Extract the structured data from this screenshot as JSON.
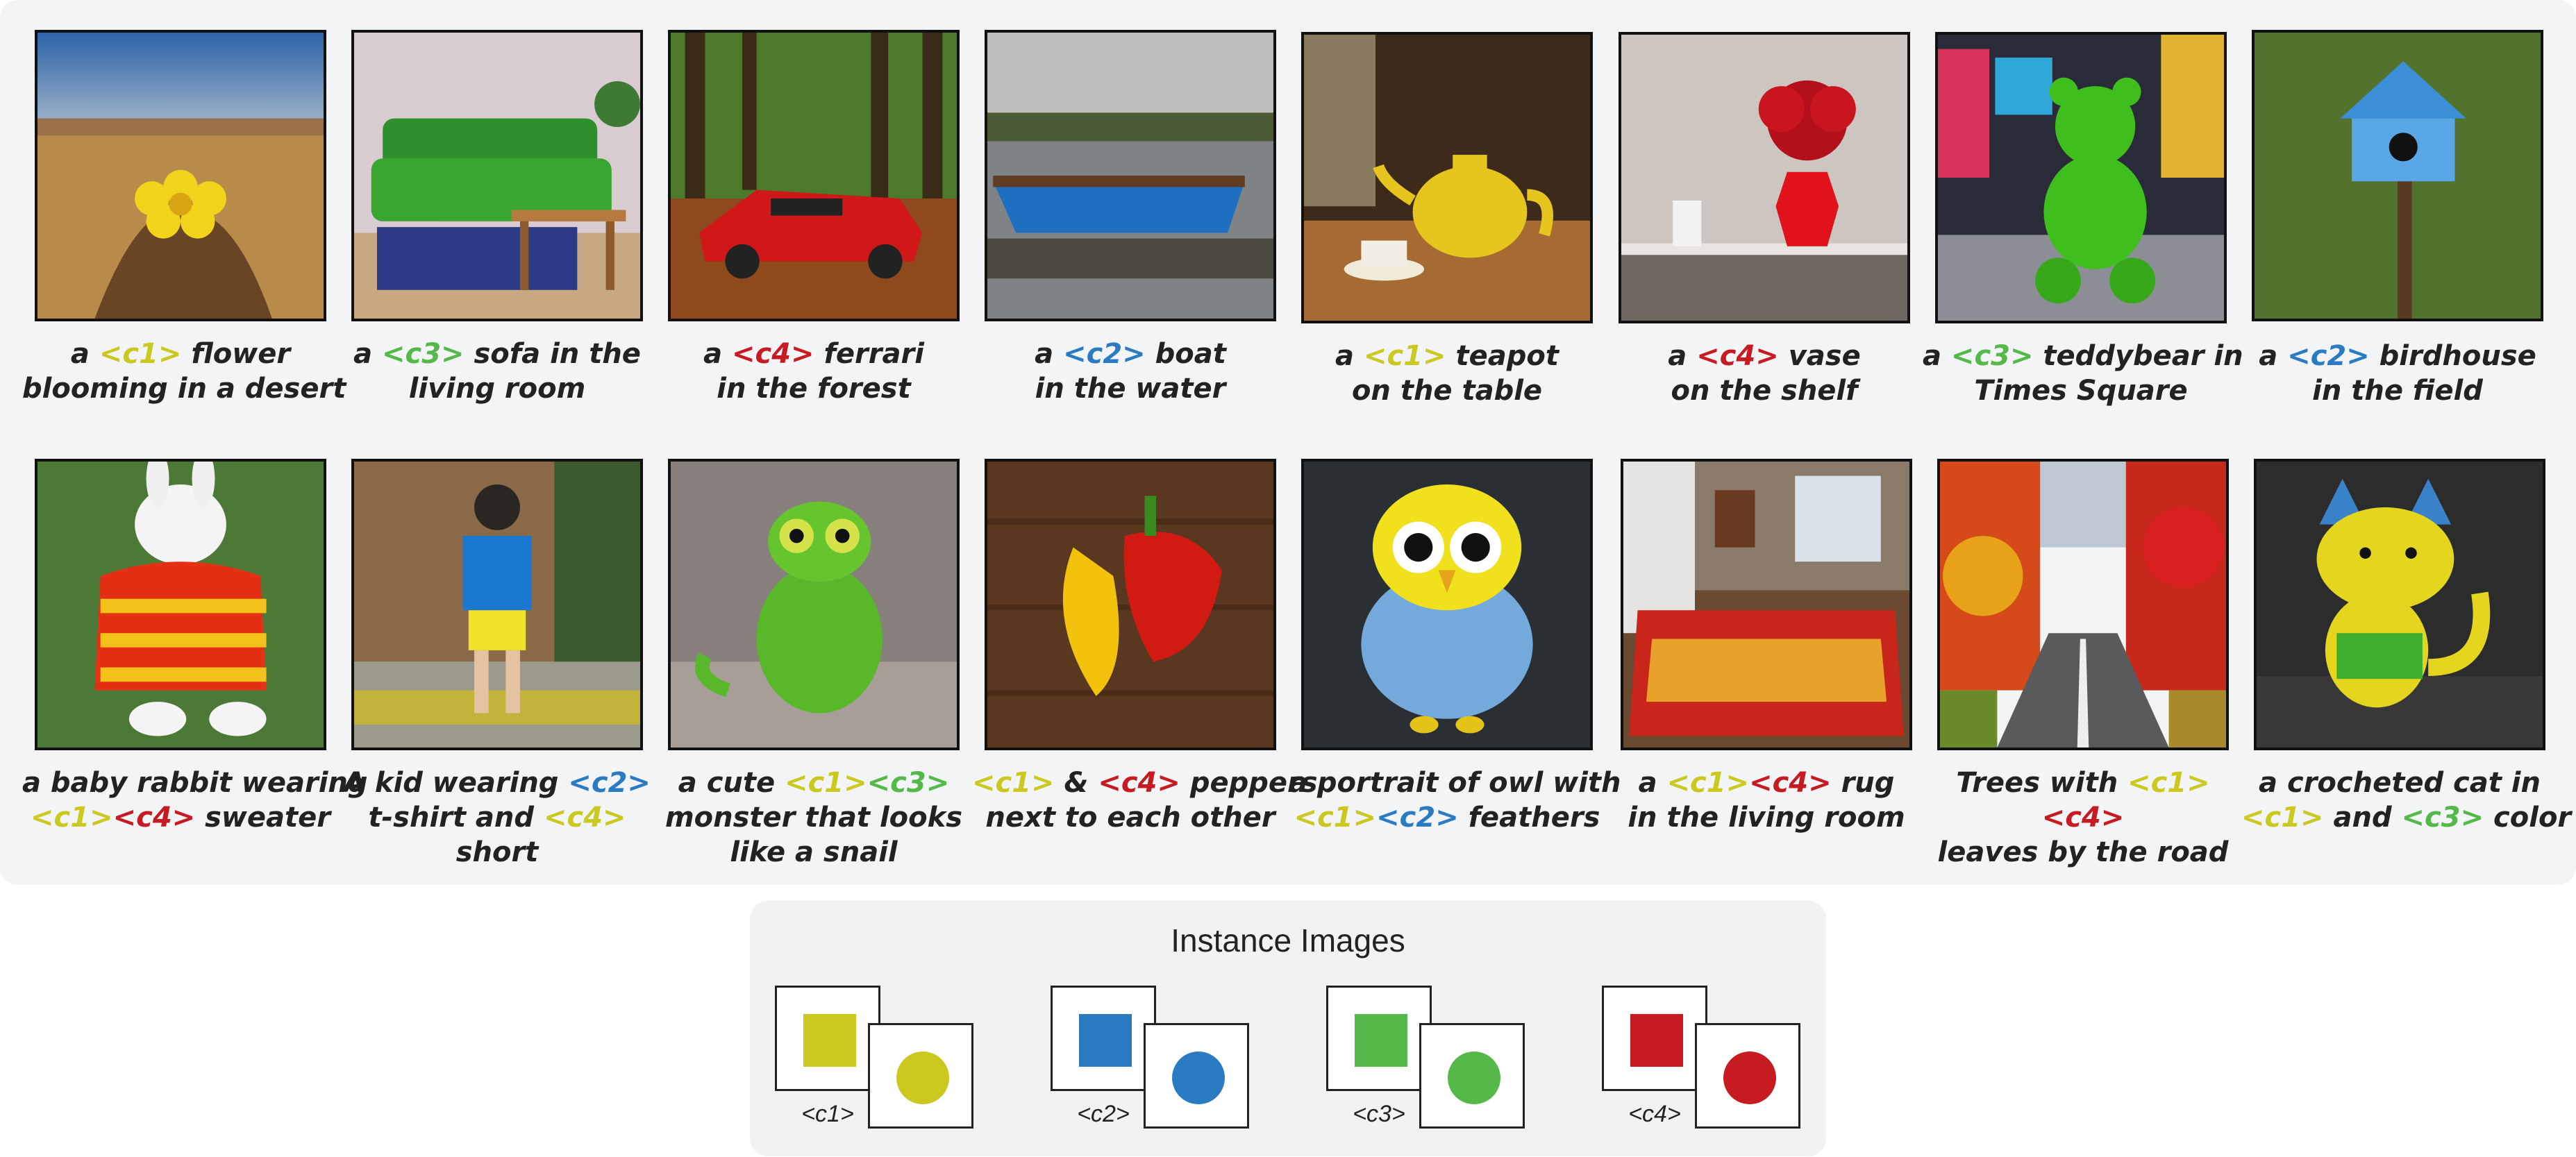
{
  "colors": {
    "c1": "#cbc920",
    "c2": "#2a7bc1",
    "c3": "#54b948",
    "c4": "#c71b22"
  },
  "examples": [
    {
      "image": "yellow flower on desert sand mound",
      "caption": [
        [
          {
            "t": "a "
          },
          {
            "t": "<c1>",
            "c": "c1"
          },
          {
            "t": " flower"
          }
        ],
        [
          {
            "t": "blooming in a desert"
          }
        ]
      ]
    },
    {
      "image": "green sofa in living room",
      "caption": [
        [
          {
            "t": "a "
          },
          {
            "t": "<c3>",
            "c": "c3"
          },
          {
            "t": " sofa in the"
          }
        ],
        [
          {
            "t": "living room"
          }
        ]
      ]
    },
    {
      "image": "red ferrari in forest",
      "caption": [
        [
          {
            "t": "a "
          },
          {
            "t": "<c4>",
            "c": "c4"
          },
          {
            "t": " ferrari"
          }
        ],
        [
          {
            "t": "in the forest"
          }
        ]
      ]
    },
    {
      "image": "blue boat on water",
      "caption": [
        [
          {
            "t": "a "
          },
          {
            "t": "<c2>",
            "c": "c2"
          },
          {
            "t": " boat"
          }
        ],
        [
          {
            "t": "in the water"
          }
        ]
      ]
    },
    {
      "image": "yellow teapot on table",
      "caption": [
        [
          {
            "t": "a "
          },
          {
            "t": "<c1>",
            "c": "c1"
          },
          {
            "t": " teapot"
          }
        ],
        [
          {
            "t": "on the table"
          }
        ]
      ]
    },
    {
      "image": "red vase with flowers on shelf",
      "caption": [
        [
          {
            "t": "a "
          },
          {
            "t": "<c4>",
            "c": "c4"
          },
          {
            "t": " vase"
          }
        ],
        [
          {
            "t": "on the shelf"
          }
        ]
      ]
    },
    {
      "image": "green teddybear in Times Square",
      "caption": [
        [
          {
            "t": "a "
          },
          {
            "t": "<c3>",
            "c": "c3"
          },
          {
            "t": " teddybear in"
          }
        ],
        [
          {
            "t": "Times Square"
          }
        ]
      ]
    },
    {
      "image": "blue birdhouse in grass field",
      "caption": [
        [
          {
            "t": "a "
          },
          {
            "t": "<c2>",
            "c": "c2"
          },
          {
            "t": " birdhouse"
          }
        ],
        [
          {
            "t": "in the field"
          }
        ]
      ]
    },
    {
      "image": "baby rabbit in striped sweater",
      "caption": [
        [
          {
            "t": "a baby rabbit wearing"
          }
        ],
        [
          {
            "t": "<c1>",
            "c": "c1"
          },
          {
            "t": "<c4>",
            "c": "c4"
          },
          {
            "t": " sweater"
          }
        ]
      ]
    },
    {
      "image": "kid in blue t-shirt and yellow shorts",
      "caption": [
        [
          {
            "t": "A kid wearing "
          },
          {
            "t": "<c2>",
            "c": "c2"
          }
        ],
        [
          {
            "t": "t-shirt and "
          },
          {
            "t": "<c4>",
            "c": "c1"
          }
        ],
        [
          {
            "t": "short"
          }
        ]
      ]
    },
    {
      "image": "green knitted snail monster",
      "caption": [
        [
          {
            "t": "a cute "
          },
          {
            "t": "<c1>",
            "c": "c1"
          },
          {
            "t": "<c3>",
            "c": "c3"
          }
        ],
        [
          {
            "t": "monster that looks"
          }
        ],
        [
          {
            "t": "like a snail"
          }
        ]
      ]
    },
    {
      "image": "yellow and red peppers on wood",
      "caption": [
        [
          {
            "t": "<c1>",
            "c": "c1"
          },
          {
            "t": " & "
          },
          {
            "t": "<c4>",
            "c": "c4"
          },
          {
            "t": " peppers"
          }
        ],
        [
          {
            "t": "next to each other"
          }
        ]
      ]
    },
    {
      "image": "fluffy yellow and blue owl",
      "caption": [
        [
          {
            "t": "a portrait of owl with"
          }
        ],
        [
          {
            "t": "<c1>",
            "c": "c1"
          },
          {
            "t": "<c2>",
            "c": "c2"
          },
          {
            "t": " feathers"
          }
        ]
      ]
    },
    {
      "image": "red and yellow rug in living room",
      "caption": [
        [
          {
            "t": "a "
          },
          {
            "t": "<c1>",
            "c": "c1"
          },
          {
            "t": "<c4>",
            "c": "c4"
          },
          {
            "t": " rug"
          }
        ],
        [
          {
            "t": "in the living room"
          }
        ]
      ]
    },
    {
      "image": "road with autumn trees",
      "caption": [
        [
          {
            "t": "Trees with "
          },
          {
            "t": "<c1>",
            "c": "c1"
          },
          {
            "t": "<c4>",
            "c": "c4"
          }
        ],
        [
          {
            "t": "leaves by the road"
          }
        ]
      ]
    },
    {
      "image": "crocheted yellow and green cat",
      "caption": [
        [
          {
            "t": "a crocheted cat in"
          }
        ],
        [
          {
            "t": "<c1>",
            "c": "c1"
          },
          {
            "t": " and "
          },
          {
            "t": "<c3>",
            "c": "c3"
          },
          {
            "t": " color"
          }
        ]
      ]
    }
  ],
  "legend": {
    "title": "Instance Images",
    "tokens": [
      {
        "label": "<c1>",
        "color": "c1"
      },
      {
        "label": "<c2>",
        "color": "c2"
      },
      {
        "label": "<c3>",
        "color": "c3"
      },
      {
        "label": "<c4>",
        "color": "c4"
      }
    ]
  }
}
